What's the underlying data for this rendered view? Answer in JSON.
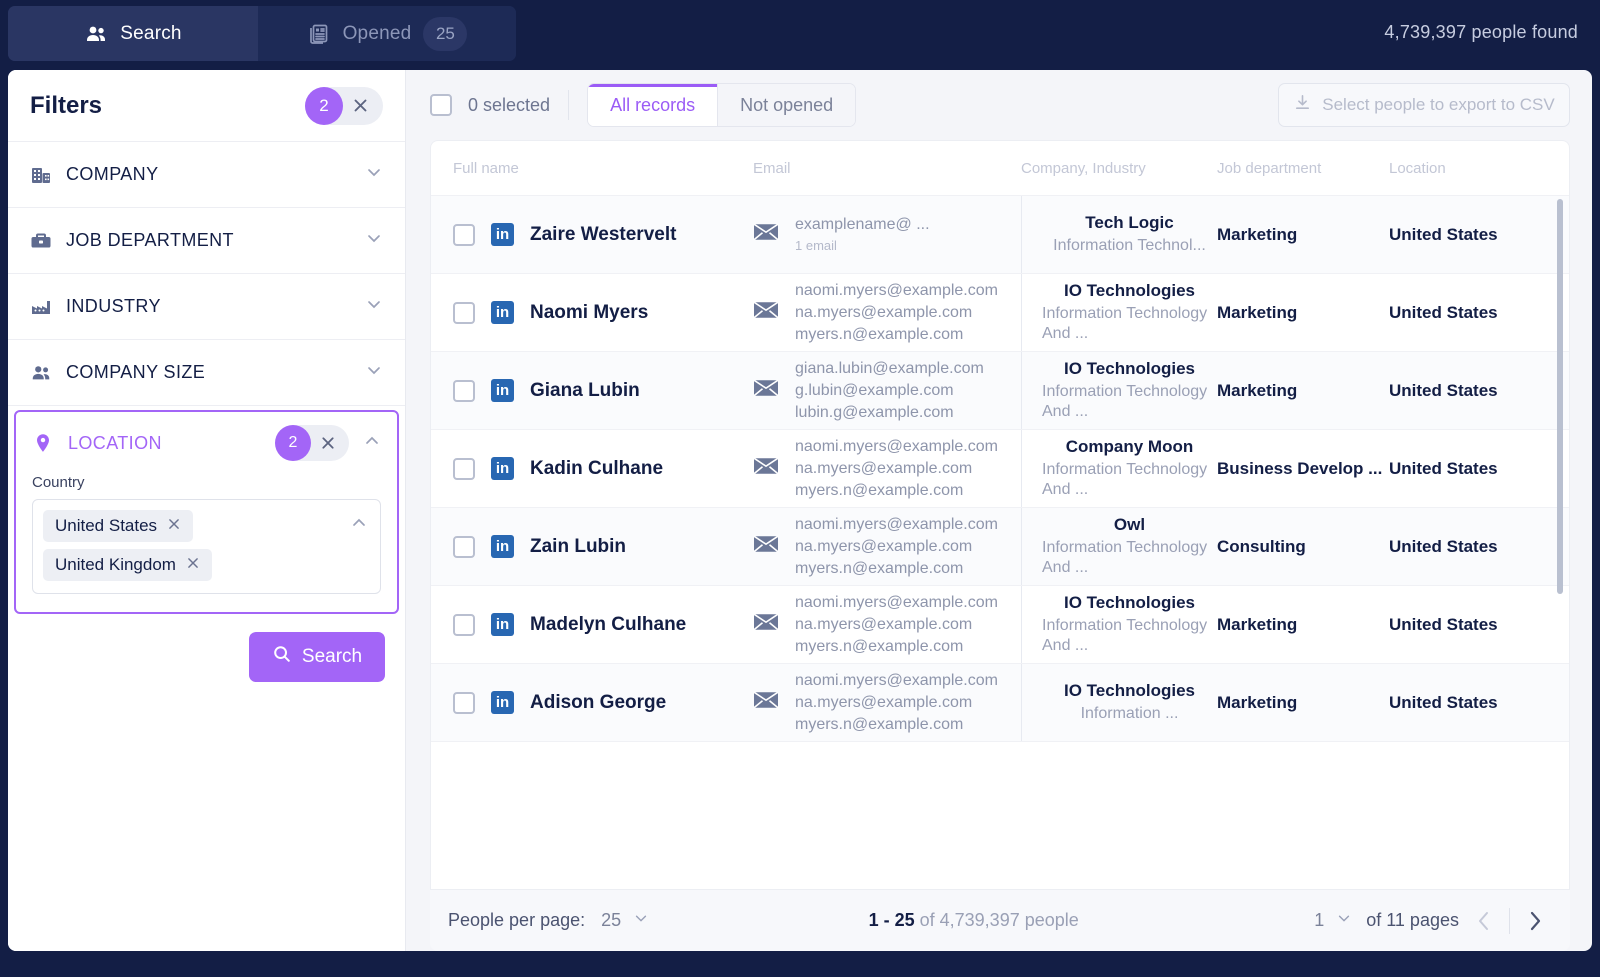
{
  "header": {
    "tabs": [
      {
        "label": "Search",
        "icon": "people-icon",
        "active": true
      },
      {
        "label": "Opened",
        "icon": "list-icon",
        "badge": "25",
        "active": false
      }
    ],
    "people_found": "4,739,397 people found"
  },
  "sidebar": {
    "title": "Filters",
    "active_count": "2",
    "clear_icon": "close-icon",
    "filters": [
      {
        "label": "COMPANY",
        "icon": "building-icon"
      },
      {
        "label": "JOB DEPARTMENT",
        "icon": "briefcase-icon"
      },
      {
        "label": "INDUSTRY",
        "icon": "factory-icon"
      },
      {
        "label": "COMPANY SIZE",
        "icon": "people-icon"
      }
    ],
    "location": {
      "label": "LOCATION",
      "icon": "map-pin-icon",
      "count": "2",
      "field_label": "Country",
      "chips": [
        "United States",
        "United Kingdom"
      ]
    },
    "search_button": "Search"
  },
  "toolbar": {
    "selected_label": "0 selected",
    "segments": [
      {
        "label": "All records",
        "active": true
      },
      {
        "label": "Not opened",
        "active": false
      }
    ],
    "export_label": "Select people to export to CSV",
    "export_icon": "download-icon"
  },
  "table": {
    "columns": [
      "Full name",
      "Email",
      "Company, Industry",
      "Job department",
      "Location"
    ],
    "rows": [
      {
        "name": "Zaire Westervelt",
        "emails": [
          "examplename@ ..."
        ],
        "email_note": "1 email",
        "company": "Tech Logic",
        "industry": "Information Technol...",
        "department": "Marketing",
        "location": "United States"
      },
      {
        "name": "Naomi Myers",
        "emails": [
          "naomi.myers@example.com",
          "na.myers@example.com",
          "myers.n@example.com"
        ],
        "email_note": "",
        "company": "IO Technologies",
        "industry": "Information Technology And ...",
        "department": "Marketing",
        "location": "United States"
      },
      {
        "name": "Giana Lubin",
        "emails": [
          "giana.lubin@example.com",
          "g.lubin@example.com",
          "lubin.g@example.com"
        ],
        "email_note": "",
        "company": "IO Technologies",
        "industry": "Information Technology And ...",
        "department": "Marketing",
        "location": "United States"
      },
      {
        "name": "Kadin Culhane",
        "emails": [
          "naomi.myers@example.com",
          "na.myers@example.com",
          "myers.n@example.com"
        ],
        "email_note": "",
        "company": "Company Moon",
        "industry": "Information Technology And ...",
        "department": "Business Develop ...",
        "location": "United States"
      },
      {
        "name": "Zain Lubin",
        "emails": [
          "naomi.myers@example.com",
          "na.myers@example.com",
          "myers.n@example.com"
        ],
        "email_note": "",
        "company": "Owl",
        "industry": "Information Technology And ...",
        "department": "Consulting",
        "location": "United States"
      },
      {
        "name": "Madelyn Culhane",
        "emails": [
          "naomi.myers@example.com",
          "na.myers@example.com",
          "myers.n@example.com"
        ],
        "email_note": "",
        "company": "IO Technologies",
        "industry": "Information Technology And ...",
        "department": "Marketing",
        "location": "United States"
      },
      {
        "name": "Adison George",
        "emails": [
          "naomi.myers@example.com",
          "na.myers@example.com",
          "myers.n@example.com"
        ],
        "email_note": "",
        "company": "IO Technologies",
        "industry": "Information ...",
        "department": "Marketing",
        "location": "United States"
      }
    ]
  },
  "pagination": {
    "per_page_label": "People per page:",
    "per_page_value": "25",
    "range_current": "1 - 25",
    "range_total": "of 4,739,397 people",
    "page_value": "1",
    "page_total": "of 11 pages",
    "prev_icon": "chevron-left-icon",
    "next_icon": "chevron-right-icon"
  },
  "colors": {
    "accent": "#a365f7",
    "navy": "#131e45",
    "linkedin": "#2867b2"
  }
}
